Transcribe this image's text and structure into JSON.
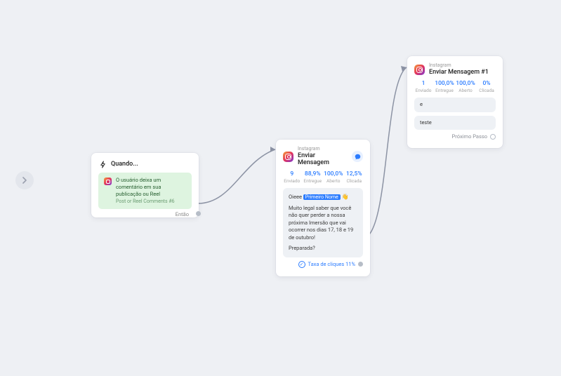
{
  "sidebar": {
    "expand_btn": "expand"
  },
  "node1": {
    "title": "Quando...",
    "pill_main": "O usuário deixa um comentário em sua publicação ou Reel",
    "pill_sub": "Post or Reel Comments #6",
    "out_label": "Então"
  },
  "node2": {
    "subtitle": "Instagram",
    "title": "Enviar Mensagem",
    "stats": [
      {
        "val": "9",
        "lbl": "Enviado"
      },
      {
        "val": "88,9%",
        "lbl": "Entregue"
      },
      {
        "val": "100,0%",
        "lbl": "Aberto"
      },
      {
        "val": "12,5%",
        "lbl": "Clicada"
      }
    ],
    "msg_greet_prefix": "Oieee ",
    "msg_chip": "Primeiro Nome",
    "msg_emoji": "👋",
    "msg_body": "Muito legal saber que você não quer perder a nossa próxima Imersão que vai ocorrer nos dias 17, 18 e 19 de outubro!",
    "msg_q": "Preparada?",
    "cta_icon": "✓",
    "cta_text": "Taxa de cliques 11%"
  },
  "node3": {
    "subtitle": "Instagram",
    "title": "Enviar Mensagem #1",
    "stats": [
      {
        "val": "1",
        "lbl": "Enviado"
      },
      {
        "val": "100,0%",
        "lbl": "Entregue"
      },
      {
        "val": "100,0%",
        "lbl": "Aberto"
      },
      {
        "val": "0%",
        "lbl": "Clicada"
      }
    ],
    "bubble1": "e",
    "bubble2": "teste",
    "next_label": "Próximo Passo"
  }
}
